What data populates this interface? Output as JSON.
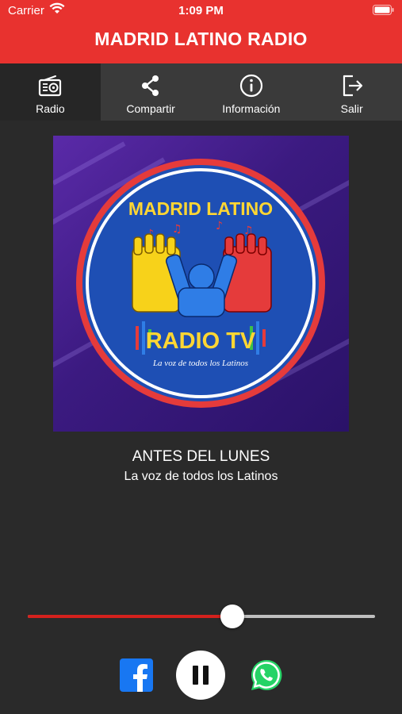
{
  "status_bar": {
    "carrier": "Carrier",
    "time": "1:09 PM"
  },
  "header": {
    "title": "MADRID LATINO RADIO",
    "color": "#e8322f"
  },
  "tabs": [
    {
      "label": "Radio",
      "icon": "radio-icon",
      "active": true
    },
    {
      "label": "Compartir",
      "icon": "share-icon",
      "active": false
    },
    {
      "label": "Información",
      "icon": "info-icon",
      "active": false
    },
    {
      "label": "Salir",
      "icon": "exit-icon",
      "active": false
    }
  ],
  "artwork": {
    "top_text": "MADRID LATINO",
    "bottom_text": "RADIO TV",
    "tagline": "La voz de todos los Latinos"
  },
  "now_playing": {
    "title": "ANTES DEL LUNES",
    "subtitle": "La voz de todos los Latinos"
  },
  "volume": {
    "level": 0.59,
    "fill_color": "#d4211d"
  },
  "controls": {
    "facebook_icon": "facebook-icon",
    "pause_icon": "pause-icon",
    "whatsapp_icon": "whatsapp-icon"
  }
}
